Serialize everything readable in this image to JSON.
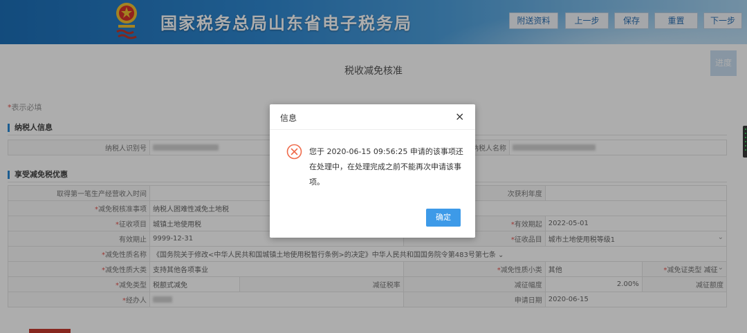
{
  "header": {
    "title": "国家税务总局山东省电子税务局",
    "buttons": [
      "附送资料",
      "上一步",
      "保存",
      "重置",
      "下一步"
    ]
  },
  "page": {
    "title": "税收减免核准",
    "progress_label": "进度",
    "required_star": "*",
    "required_note": "表示必填"
  },
  "sections": {
    "taxpayer": "纳税人信息",
    "benefit": "享受减免税优惠"
  },
  "taxpayer": {
    "id_label": "纳税人识别号",
    "name_label": "纳税人名称"
  },
  "benefit": {
    "first_income_label": "取得第一笔生产经营收入时间",
    "profit_year_label": "次获利年度",
    "matter_label": "减免税核准事项",
    "matter_value": "纳税人困难性减免土地税",
    "item_label": "征收项目",
    "item_value": "城镇土地使用税",
    "start_label": "有效期起",
    "start_value": "2022-05-01",
    "end_label": "有效期止",
    "end_value": "9999-12-31",
    "subitem_label": "征收品目",
    "subitem_value": "城市土地使用税等级1",
    "nature_name_label": "减免性质名称",
    "nature_name_value": "《国务院关于修改<中华人民共和国城镇土地使用税暂行条例>的决定》中华人民共和国国务院令第483号第七条",
    "major_label": "减免性质大类",
    "major_value": "支持其他各项事业",
    "minor_label": "减免性质小类",
    "minor_value": "其他",
    "cert_type_label": "减免证类型",
    "cert_type_value": "减征",
    "type_label": "减免类型",
    "type_value": "税额式减免",
    "rate_label": "减征税率",
    "range_label": "减征幅度",
    "range_value": "2.00%",
    "amount_label": "减征额度",
    "agent_label": "经办人",
    "apply_date_label": "申请日期",
    "apply_date_value": "2020-06-15"
  },
  "dialog": {
    "title": "信息",
    "close": "×",
    "message": "您于 2020-06-15 09:56:25 申请的该事项还在处理中，在处理完成之前不能再次申请该事项。",
    "ok": "确定"
  }
}
